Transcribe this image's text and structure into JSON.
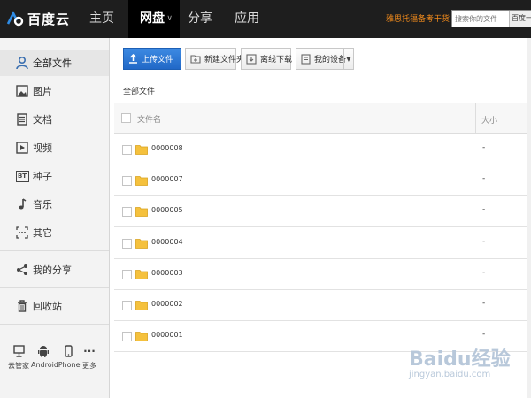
{
  "header": {
    "logo_text": "百度云",
    "nav": [
      {
        "label": "主页"
      },
      {
        "label": "网盘"
      },
      {
        "label": "分享"
      },
      {
        "label": "应用"
      }
    ],
    "promo": "雅思托福备考干货",
    "search": {
      "placeholder": "搜索你的文件",
      "button_label": "百度一"
    }
  },
  "sidebar": {
    "items": [
      {
        "label": "全部文件",
        "icon": "user-home-icon"
      },
      {
        "label": "图片",
        "icon": "image-icon"
      },
      {
        "label": "文档",
        "icon": "document-icon"
      },
      {
        "label": "视频",
        "icon": "video-icon"
      },
      {
        "label": "种子",
        "icon": "bt-icon",
        "glyph": "BT"
      },
      {
        "label": "音乐",
        "icon": "music-icon"
      },
      {
        "label": "其它",
        "icon": "more-dots-icon"
      },
      {
        "label": "我的分享",
        "icon": "share-icon"
      },
      {
        "label": "回收站",
        "icon": "trash-icon"
      }
    ],
    "devices": [
      {
        "label": "云管家",
        "icon": "desktop-icon"
      },
      {
        "label": "Android",
        "icon": "android-icon"
      },
      {
        "label": "iPhone",
        "icon": "iphone-icon"
      },
      {
        "label": "更多",
        "icon": "more-icon",
        "glyph": "···"
      }
    ]
  },
  "toolbar": {
    "upload_label": "上传文件",
    "new_folder_label": "新建文件夹",
    "offline_label": "离线下载",
    "device_label": "我的设备"
  },
  "breadcrumb": "全部文件",
  "table": {
    "columns": [
      "文件名",
      "大小"
    ],
    "rows": [
      {
        "name": "0000008",
        "size": "-"
      },
      {
        "name": "0000007",
        "size": "-"
      },
      {
        "name": "0000005",
        "size": "-"
      },
      {
        "name": "0000004",
        "size": "-"
      },
      {
        "name": "0000003",
        "size": "-"
      },
      {
        "name": "0000002",
        "size": "-"
      },
      {
        "name": "0000001",
        "size": "-"
      }
    ]
  },
  "watermark": {
    "text": "Baidu经验",
    "sub": "jingyan.baidu.com"
  },
  "colors": {
    "topbar": "#1e1e1e",
    "upload_button": "#2a74d3",
    "promo": "#f08a1c",
    "folder": "#f5c13d"
  }
}
